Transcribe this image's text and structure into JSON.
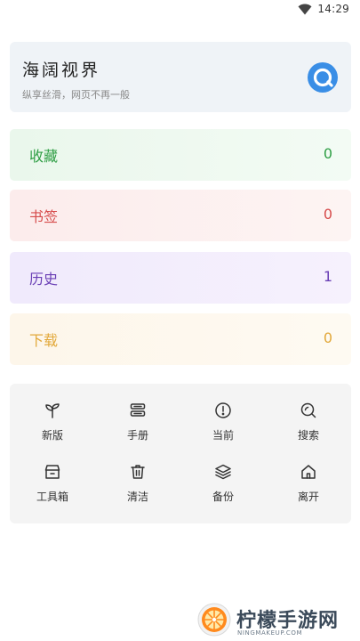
{
  "status_bar": {
    "time": "14:29"
  },
  "header": {
    "title": "海阔视界",
    "subtitle": "纵享丝滑，网页不再一般",
    "brand_color": "#3a8ee6"
  },
  "stats": [
    {
      "label": "收藏",
      "value": "0",
      "color": "#2e9e44"
    },
    {
      "label": "书签",
      "value": "0",
      "color": "#d64b4b"
    },
    {
      "label": "历史",
      "value": "1",
      "color": "#6a3fb5"
    },
    {
      "label": "下载",
      "value": "0",
      "color": "#e2a83a"
    }
  ],
  "tools": [
    {
      "label": "新版",
      "icon": "sprout-icon"
    },
    {
      "label": "手册",
      "icon": "manual-icon"
    },
    {
      "label": "当前",
      "icon": "info-circle-icon"
    },
    {
      "label": "搜索",
      "icon": "search-icon"
    },
    {
      "label": "工具箱",
      "icon": "toolbox-icon"
    },
    {
      "label": "清洁",
      "icon": "trash-icon"
    },
    {
      "label": "备份",
      "icon": "layers-icon"
    },
    {
      "label": "离开",
      "icon": "home-icon"
    }
  ],
  "watermark": {
    "text": "柠檬手游网",
    "sub": "NINGMAKEUP.COM"
  }
}
